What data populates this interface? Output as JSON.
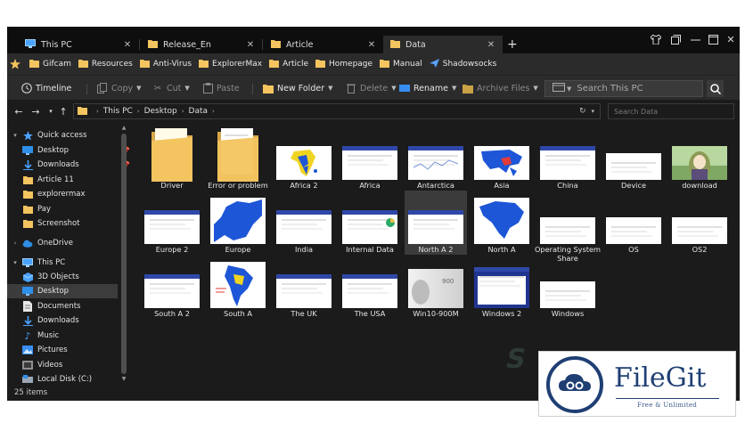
{
  "tabs": [
    {
      "label": "This PC",
      "icon": "monitor-icon"
    },
    {
      "label": "Release_En",
      "icon": "folder-icon"
    },
    {
      "label": "Article",
      "icon": "folder-icon"
    },
    {
      "label": "Data",
      "icon": "folder-icon",
      "active": true
    }
  ],
  "bookmarks": [
    "Gifcam",
    "Resources",
    "Anti-Virus",
    "ExplorerMax",
    "Article",
    "Homepage",
    "Manual",
    "Shadowsocks"
  ],
  "toolbar": {
    "timeline": "Timeline",
    "copy": "Copy",
    "cut": "Cut",
    "paste": "Paste",
    "new_folder": "New Folder",
    "delete": "Delete",
    "rename": "Rename",
    "archive": "Archive Files",
    "search_placeholder": "Search This PC"
  },
  "address": {
    "crumbs": [
      "This PC",
      "Desktop",
      "Data"
    ],
    "search_placeholder": "Search Data"
  },
  "sidebar": [
    {
      "label": "Quick access",
      "icon": "star-icon",
      "chev": true
    },
    {
      "label": "Desktop",
      "icon": "desktop-icon",
      "pin": true
    },
    {
      "label": "Downloads",
      "icon": "download-icon",
      "pin": true
    },
    {
      "label": "Article 11",
      "icon": "folder-icon"
    },
    {
      "label": "explorermax",
      "icon": "folder-icon"
    },
    {
      "label": "Pay",
      "icon": "folder-icon"
    },
    {
      "label": "Screenshot",
      "icon": "folder-icon"
    },
    {
      "label": "OneDrive",
      "icon": "cloud-icon",
      "chev": true
    },
    {
      "label": "This PC",
      "icon": "monitor-icon",
      "chev": true,
      "expanded": true
    },
    {
      "label": "3D Objects",
      "icon": "cube-icon"
    },
    {
      "label": "Desktop",
      "icon": "desktop-icon",
      "selected": true
    },
    {
      "label": "Documents",
      "icon": "document-icon"
    },
    {
      "label": "Downloads",
      "icon": "download-icon"
    },
    {
      "label": "Music",
      "icon": "music-icon"
    },
    {
      "label": "Pictures",
      "icon": "picture-icon"
    },
    {
      "label": "Videos",
      "icon": "video-icon"
    },
    {
      "label": "Local Disk (C:)",
      "icon": "disk-icon"
    }
  ],
  "files": [
    {
      "name": "Driver",
      "kind": "folder"
    },
    {
      "name": "Error or problem",
      "kind": "folder-docs"
    },
    {
      "name": "Africa 2",
      "kind": "map-africa"
    },
    {
      "name": "Africa",
      "kind": "web"
    },
    {
      "name": "Antarctica",
      "kind": "web-line"
    },
    {
      "name": "Asia",
      "kind": "map-asia"
    },
    {
      "name": "China",
      "kind": "web"
    },
    {
      "name": "Device",
      "kind": "web-plain"
    },
    {
      "name": "download",
      "kind": "anime"
    },
    {
      "name": "Europe 2",
      "kind": "web"
    },
    {
      "name": "Europe",
      "kind": "map-europe"
    },
    {
      "name": "India",
      "kind": "web"
    },
    {
      "name": "Internal Data",
      "kind": "web-pie"
    },
    {
      "name": "North A 2",
      "kind": "web",
      "selected": true
    },
    {
      "name": "North A",
      "kind": "map-na"
    },
    {
      "name": "Operating System Share",
      "kind": "web-plain"
    },
    {
      "name": "OS",
      "kind": "web-plain"
    },
    {
      "name": "OS2",
      "kind": "web-plain"
    },
    {
      "name": "South A 2",
      "kind": "web"
    },
    {
      "name": "South A",
      "kind": "map-sa"
    },
    {
      "name": "The UK",
      "kind": "web"
    },
    {
      "name": "The USA",
      "kind": "web"
    },
    {
      "name": "Win10-900M",
      "kind": "grey"
    },
    {
      "name": "Windows 2",
      "kind": "dark-web"
    },
    {
      "name": "Windows",
      "kind": "web-plain"
    }
  ],
  "status": {
    "count": "25 items"
  },
  "watermark": {
    "name": "FileGit",
    "tagline": "Free & Unlimited"
  },
  "colors": {
    "accent": "#2f48a8",
    "folder": "#f3c45f",
    "map_blue": "#1d56d6",
    "map_yellow": "#f0d422"
  }
}
